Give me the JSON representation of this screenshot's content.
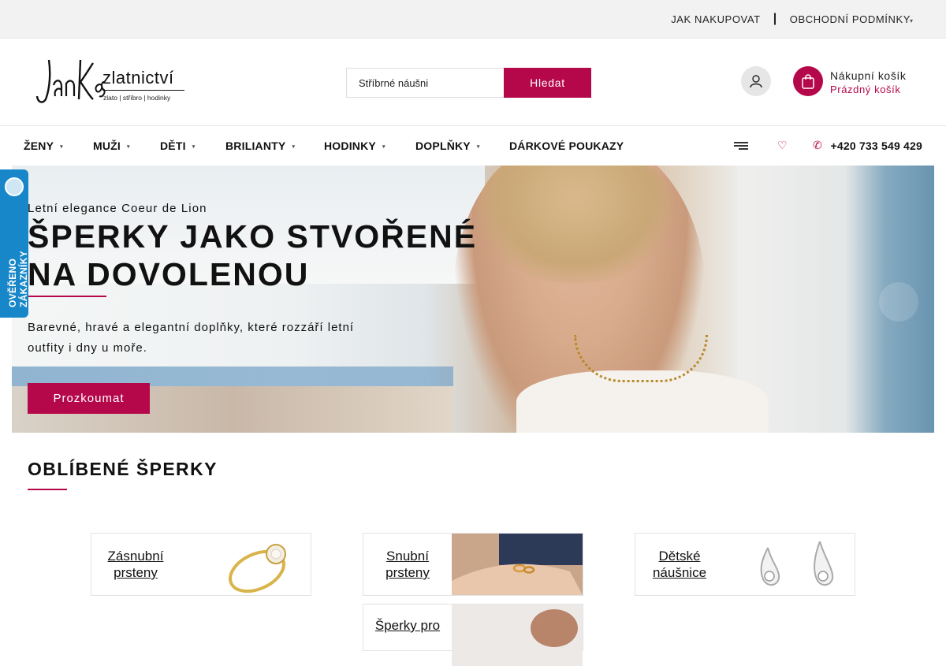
{
  "topbar": {
    "links": [
      "JAK NAKUPOVAT",
      "OBCHODNÍ PODMÍNKY"
    ],
    "separator": "|"
  },
  "logo": {
    "signature": "Jan Kos",
    "brand": "zlatnictví",
    "tagline": "zlato | stříbro | hodinky"
  },
  "search": {
    "value": "Stříbrné náušni",
    "button": "Hledat"
  },
  "cart": {
    "title": "Nákupní košík",
    "status": "Prázdný košík"
  },
  "nav": {
    "items": [
      "ŽENY",
      "MUŽI",
      "DĚTI",
      "BRILIANTY",
      "HODINKY",
      "DOPLŇKY",
      "DÁRKOVÉ POUKAZY"
    ],
    "phone": "+420 733 549 429"
  },
  "badge": {
    "text": "OVĚŘENO ZÁKAZNÍKY"
  },
  "hero": {
    "kicker": "Letní elegance Coeur de Lion",
    "title": "ŠPERKY JAKO STVOŘENÉ NA DOVOLENOU",
    "description": "Barevné, hravé a elegantní doplňky, které rozzáří letní outfity i dny u moře.",
    "cta": "Prozkoumat"
  },
  "section": {
    "title": "OBLÍBENÉ ŠPERKY"
  },
  "categories": [
    {
      "label": "Zásnubní prsteny"
    },
    {
      "label": "Snubní prsteny"
    },
    {
      "label": "Dětské náušnice"
    },
    {
      "label": "Šperky pro"
    }
  ],
  "colors": {
    "accent": "#b5084a",
    "badge": "#1787c9"
  }
}
